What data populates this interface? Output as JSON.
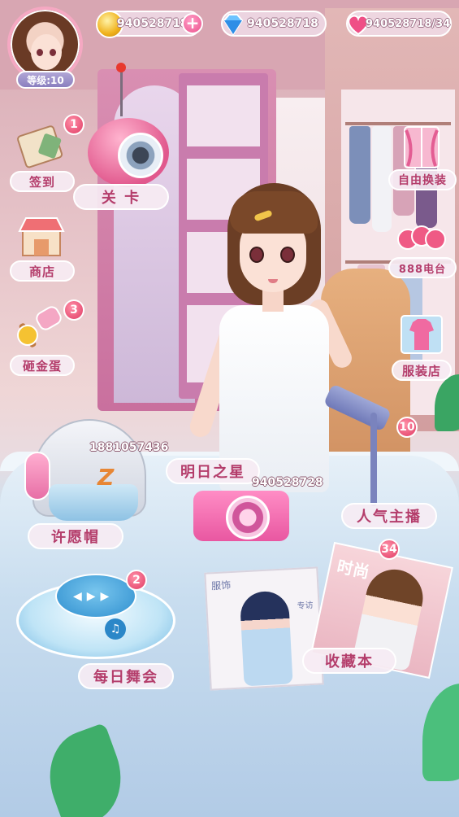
{
  "header": {
    "level_text": "等级:10",
    "gold": "940528718",
    "diamond": "940528718",
    "stamina": "940528718/34",
    "plus_symbol": "+"
  },
  "left_menu": [
    {
      "label": "签到",
      "badge": "1",
      "icon": "calendar-icon"
    },
    {
      "label": "商店",
      "badge": "",
      "icon": "shop-icon"
    },
    {
      "label": "砸金蛋",
      "badge": "3",
      "icon": "hammer-icon"
    }
  ],
  "right_menu": [
    {
      "label": "自由换装",
      "icon": "wardrobe-icon"
    },
    {
      "label": "888电台",
      "icon": "radio-888-icon"
    },
    {
      "label": "服装店",
      "icon": "clothing-store-icon"
    }
  ],
  "scene_items": {
    "level": {
      "label": "关 卡"
    },
    "wish_hat": {
      "label": "许愿帽",
      "count": "1881057436"
    },
    "star": {
      "label": "明日之星",
      "count": "940528728"
    },
    "anchor": {
      "label": "人气主播",
      "badge": "10"
    },
    "dance": {
      "label": "每日舞会",
      "badge": "2"
    },
    "collection": {
      "label": "收藏本",
      "badge": "34"
    }
  },
  "magazine": {
    "cover_left": "服饰",
    "cover_left_small": "专访",
    "cover_right": "时尚"
  },
  "colors": {
    "label_text": "#b43d6b",
    "badge_red": "#e03b64",
    "pill_border": "#ffffff",
    "level_badge": "#8a7fbf"
  }
}
